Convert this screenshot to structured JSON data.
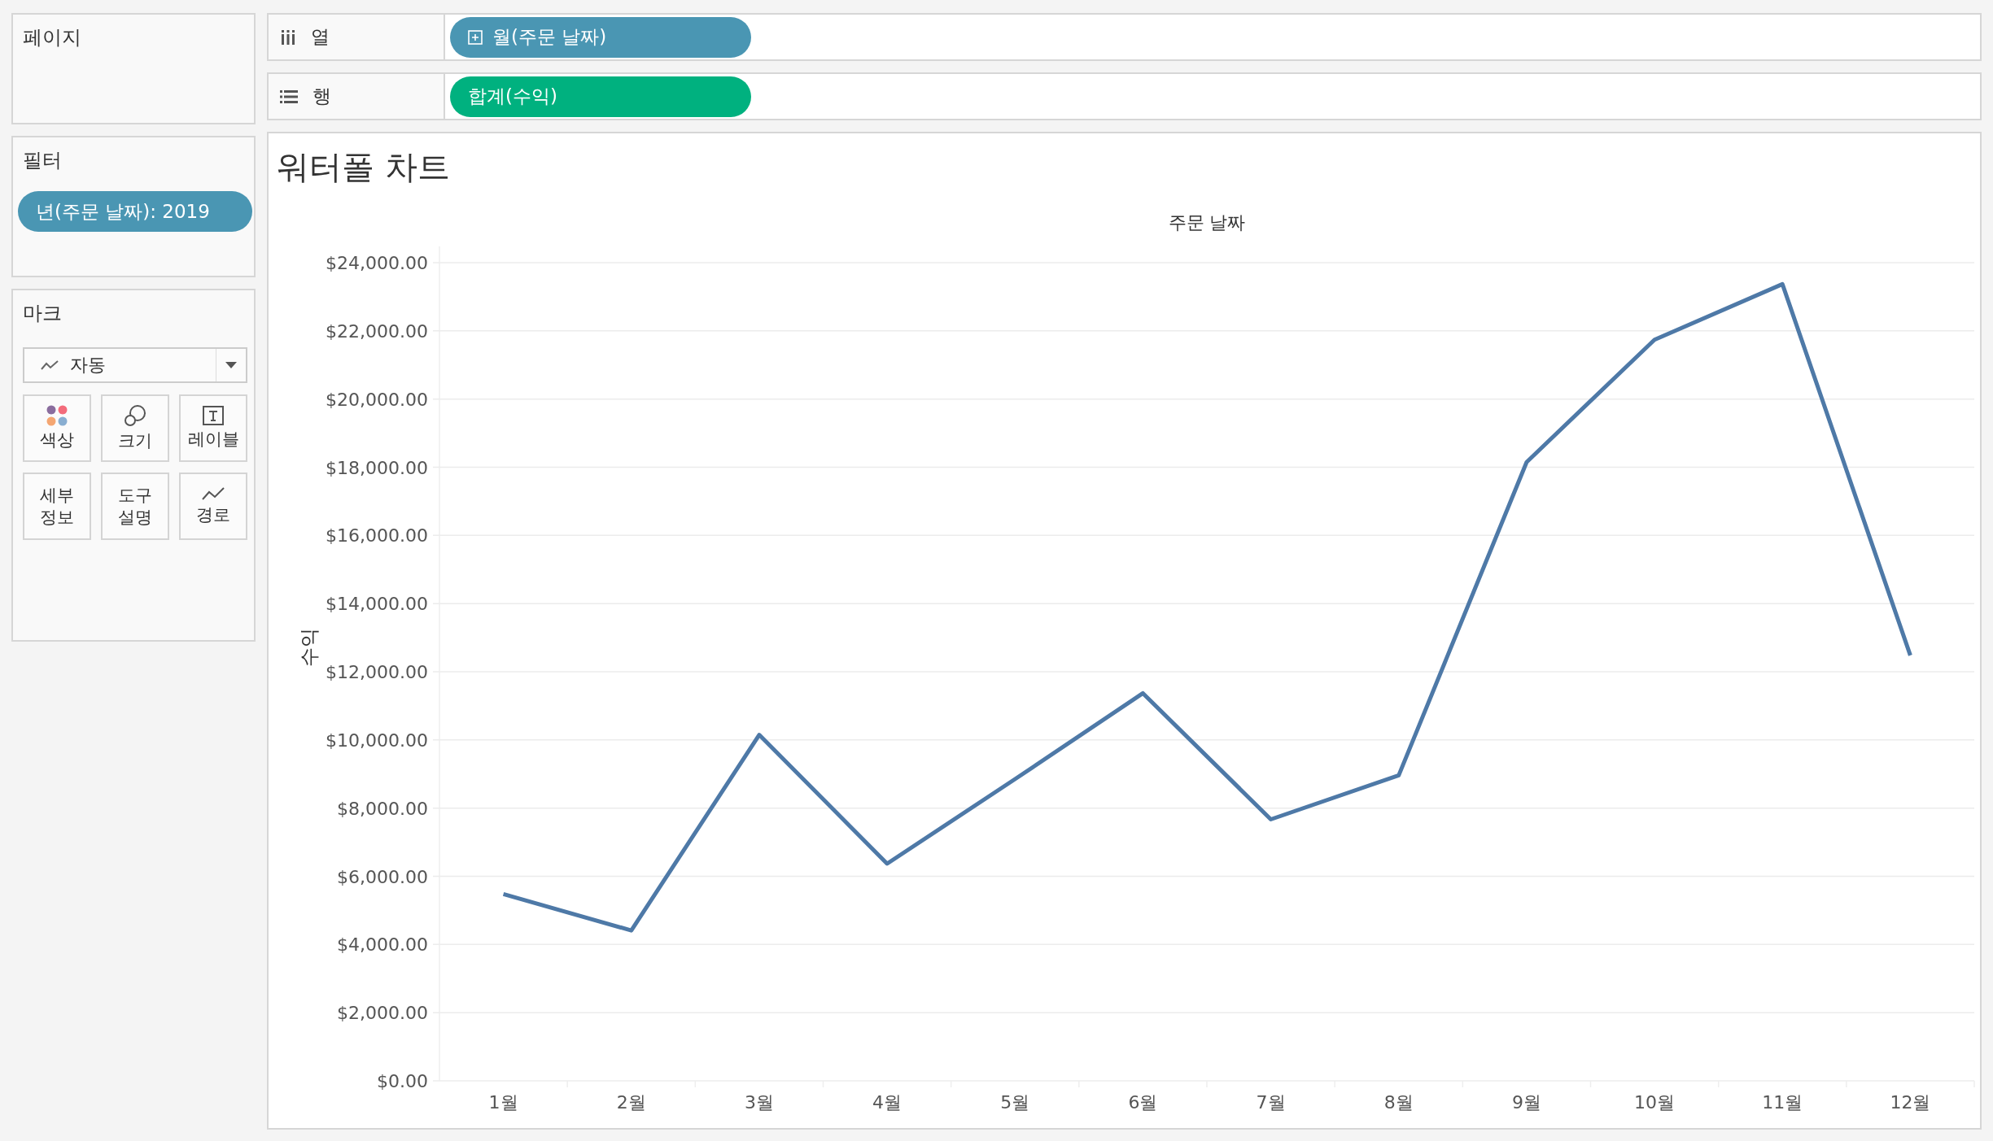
{
  "pages_card": {
    "title": "페이지"
  },
  "filters_card": {
    "title": "필터",
    "pills": [
      {
        "label": "년(주문 날짜): 2019",
        "kind": "discrete"
      }
    ]
  },
  "marks_card": {
    "title": "마크",
    "mark_type": "자동",
    "buttons": [
      {
        "kind": "color",
        "lines": [
          "색상"
        ]
      },
      {
        "kind": "size",
        "lines": [
          "크기"
        ]
      },
      {
        "kind": "label",
        "lines": [
          "레이블"
        ]
      },
      {
        "kind": "detail",
        "lines": [
          "세부",
          "정보"
        ]
      },
      {
        "kind": "tooltip",
        "lines": [
          "도구",
          "설명"
        ]
      },
      {
        "kind": "path",
        "lines": [
          "경로"
        ]
      }
    ]
  },
  "shelves": [
    {
      "kind": "columns",
      "label": "열",
      "pills": [
        {
          "label": "월(주문 날짜)",
          "kind": "discrete",
          "expandable": true
        }
      ]
    },
    {
      "kind": "rows",
      "label": "행",
      "pills": [
        {
          "label": "합계(수익)",
          "kind": "continuous",
          "expandable": false
        }
      ]
    }
  ],
  "sheet": {
    "title": "워터폴 차트",
    "chart_data": {
      "type": "line",
      "xlabel": "주문 날짜",
      "ylabel": "수익",
      "categories": [
        "1월",
        "2월",
        "3월",
        "4월",
        "5월",
        "6월",
        "7월",
        "8월",
        "9월",
        "10월",
        "11월",
        "12월"
      ],
      "series": [
        {
          "color": "#4e79a7",
          "values": [
            5480,
            4410,
            10150,
            6370,
            8850,
            11370,
            7670,
            8960,
            18150,
            21740,
            23370,
            12480
          ]
        }
      ],
      "ylim": [
        0,
        24000
      ],
      "grid": true,
      "yticks": [
        {
          "value": 0,
          "label": "$0.00"
        },
        {
          "value": 2000,
          "label": "$2,000.00"
        },
        {
          "value": 4000,
          "label": "$4,000.00"
        },
        {
          "value": 6000,
          "label": "$6,000.00"
        },
        {
          "value": 8000,
          "label": "$8,000.00"
        },
        {
          "value": 10000,
          "label": "$10,000.00"
        },
        {
          "value": 12000,
          "label": "$12,000.00"
        },
        {
          "value": 14000,
          "label": "$14,000.00"
        },
        {
          "value": 16000,
          "label": "$16,000.00"
        },
        {
          "value": 18000,
          "label": "$18,000.00"
        },
        {
          "value": 20000,
          "label": "$20,000.00"
        },
        {
          "value": 22000,
          "label": "$22,000.00"
        },
        {
          "value": 24000,
          "label": "$24,000.00"
        }
      ]
    }
  }
}
